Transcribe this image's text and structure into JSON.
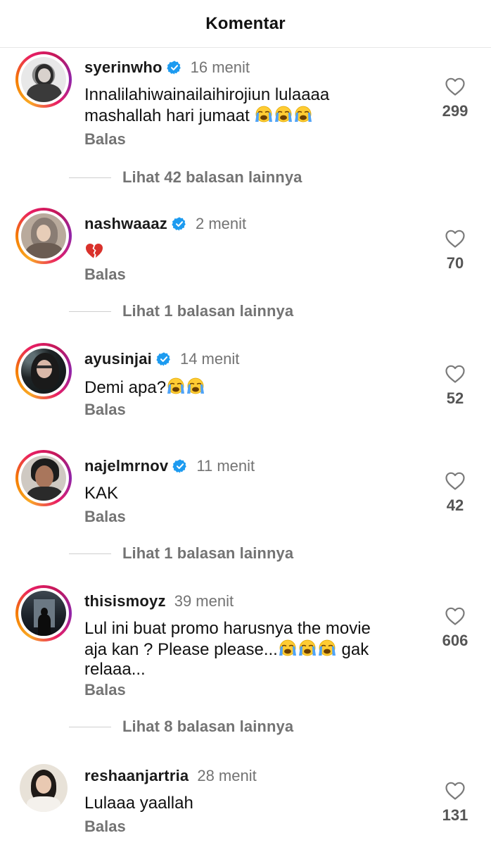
{
  "header": {
    "title": "Komentar"
  },
  "comments": [
    {
      "username": "syerinwho",
      "verified": true,
      "time": "16 menit",
      "text_line1": "Innalilahiwainailaihirojiun lulaaaa",
      "text_line2": "mashallah hari jumaat ",
      "reply": "Balas",
      "likes": "299",
      "more_replies": "Lihat 42 balasan lainnya"
    },
    {
      "username": "nashwaaaz",
      "verified": true,
      "time": "2 menit",
      "text_line1": "",
      "reply": "Balas",
      "likes": "70",
      "more_replies": "Lihat 1 balasan lainnya"
    },
    {
      "username": "ayusinjai",
      "verified": true,
      "time": "14 menit",
      "text_line1": "Demi apa?",
      "reply": "Balas",
      "likes": "52"
    },
    {
      "username": "najelmrnov",
      "verified": true,
      "time": "11 menit",
      "text_line1": "KAK",
      "reply": "Balas",
      "likes": "42",
      "more_replies": "Lihat 1 balasan lainnya"
    },
    {
      "username": "thisismoyz",
      "verified": false,
      "time": "39 menit",
      "text_line1": "Lul ini buat promo harusnya the movie",
      "text_line2a": "aja kan ? Please please...",
      "text_line2b": " gak",
      "text_line3": "relaaa...",
      "reply": "Balas",
      "likes": "606",
      "more_replies": "Lihat 8 balasan lainnya"
    },
    {
      "username": "reshaanjartria",
      "verified": false,
      "time": "28 menit",
      "text_line1": "Lulaaa yaallah",
      "reply": "Balas",
      "likes": "131"
    }
  ],
  "icons": {
    "like": "heart-outline-icon",
    "verified": "verified-badge-icon",
    "crying": "loudly-crying-face-emoji",
    "broken_heart": "broken-heart-emoji"
  },
  "colors": {
    "verified": "#1d9bf0",
    "muted": "#737373",
    "ring_start": "#f9a825",
    "ring_end": "#c2185b"
  }
}
